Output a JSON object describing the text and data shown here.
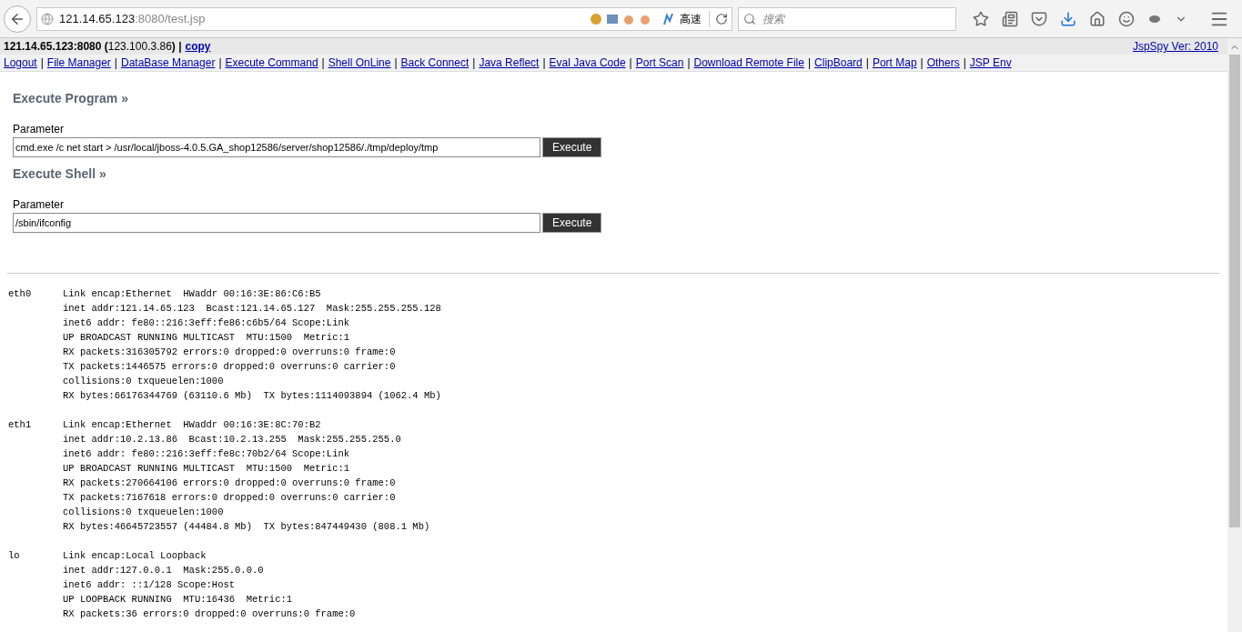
{
  "browser": {
    "url_host": "121.14.65.123",
    "url_rest": ":8080/test.jsp",
    "speed_label": "高速",
    "search_placeholder": "搜索"
  },
  "info_bar": {
    "server": "**121.14.65.123:8080 (**123.100.3.86**) |**",
    "copy_link": "copy",
    "version_link": "JspSpy Ver: 2010"
  },
  "nav": [
    {
      "label": "Logout",
      "separator": "|"
    },
    {
      "label": "File Manager",
      "separator": "|"
    },
    {
      "label": "DataBase Manager",
      "separator": "|"
    },
    {
      "label": "Execute Command",
      "separator": "|"
    },
    {
      "label": "Shell OnLine",
      "separator": "|"
    },
    {
      "label": "Back Connect",
      "separator": "|"
    },
    {
      "label": "Java Reflect",
      "separator": "|"
    },
    {
      "label": "Eval Java Code",
      "separator": "|"
    },
    {
      "label": "Port Scan",
      "separator": "|"
    },
    {
      "label": "Download Remote File",
      "separator": "|"
    },
    {
      "label": "ClipBoard",
      "separator": "|"
    },
    {
      "label": "Port Map",
      "separator": "|"
    },
    {
      "label": "Others",
      "separator": "|"
    },
    {
      "label": "JSP Env"
    }
  ],
  "sections": [
    {
      "title": "Execute Program",
      "arrow": "»",
      "field_label": "Parameter",
      "value": "cmd.exe /c net start > /usr/local/jboss-4.0.5.GA_shop12586/server/shop12586/./tmp/deploy/tmp",
      "button": "Execute"
    },
    {
      "title": "Execute Shell",
      "arrow": "»",
      "field_label": "Parameter",
      "value": "/sbin/ifconfig",
      "button": "Execute"
    }
  ],
  "output": [
    {
      "name": "eth0",
      "lines": [
        "Link encap:Ethernet  HWaddr 00:16:3E:86:C6:B5",
        "inet addr:121.14.65.123  Bcast:121.14.65.127  Mask:255.255.255.128",
        "inet6 addr: fe80::216:3eff:fe86:c6b5/64 Scope:Link",
        "UP BROADCAST RUNNING MULTICAST  MTU:1500  Metric:1",
        "RX packets:316305792 errors:0 dropped:0 overruns:0 frame:0",
        "TX packets:1446575 errors:0 dropped:0 overruns:0 carrier:0",
        "collisions:0 txqueuelen:1000",
        "RX bytes:66176344769 (63110.6 Mb)  TX bytes:1114093894 (1062.4 Mb)"
      ]
    },
    {
      "name": "eth1",
      "lines": [
        "Link encap:Ethernet  HWaddr 00:16:3E:8C:70:B2",
        "inet addr:10.2.13.86  Bcast:10.2.13.255  Mask:255.255.255.0",
        "inet6 addr: fe80::216:3eff:fe8c:70b2/64 Scope:Link",
        "UP BROADCAST RUNNING MULTICAST  MTU:1500  Metric:1",
        "RX packets:270664106 errors:0 dropped:0 overruns:0 frame:0",
        "TX packets:7167618 errors:0 dropped:0 overruns:0 carrier:0",
        "collisions:0 txqueuelen:1000",
        "RX bytes:46645723557 (44484.8 Mb)  TX bytes:847449430 (808.1 Mb)"
      ]
    },
    {
      "name": "lo",
      "lines": [
        "Link encap:Local Loopback",
        "inet addr:127.0.0.1  Mask:255.0.0.0",
        "inet6 addr: ::1/128 Scope:Host",
        "UP LOOPBACK RUNNING  MTU:16436  Metric:1",
        "RX packets:36 errors:0 dropped:0 overruns:0 frame:0"
      ]
    }
  ]
}
